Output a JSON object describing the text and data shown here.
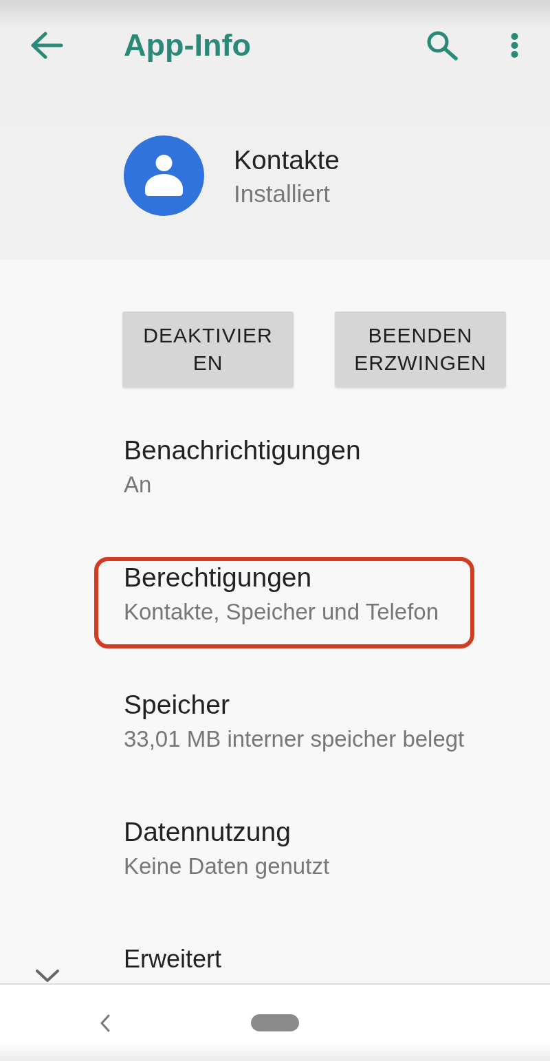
{
  "toolbar": {
    "title": "App-Info"
  },
  "app": {
    "name": "Kontakte",
    "status": "Installiert"
  },
  "buttons": [
    {
      "lines": [
        "DEAKTIVIER",
        "EN"
      ]
    },
    {
      "lines": [
        "BEENDEN",
        "ERZWINGEN"
      ]
    }
  ],
  "settings": [
    {
      "kind": "entry",
      "title": "Benachrichtigungen",
      "summary": "An",
      "highlighted": false
    },
    {
      "kind": "entry",
      "title": "Berechtigungen",
      "summary": "Kontakte, Speicher und Telefon",
      "highlighted": true
    },
    {
      "kind": "entry",
      "title": "Speicher",
      "summary": "33,01 MB interner speicher belegt",
      "highlighted": false
    },
    {
      "kind": "entry",
      "title": "Datennutzung",
      "summary": "Keine Daten genutzt",
      "highlighted": false
    },
    {
      "kind": "expander",
      "title": "Erweitert",
      "highlighted": false
    }
  ]
}
